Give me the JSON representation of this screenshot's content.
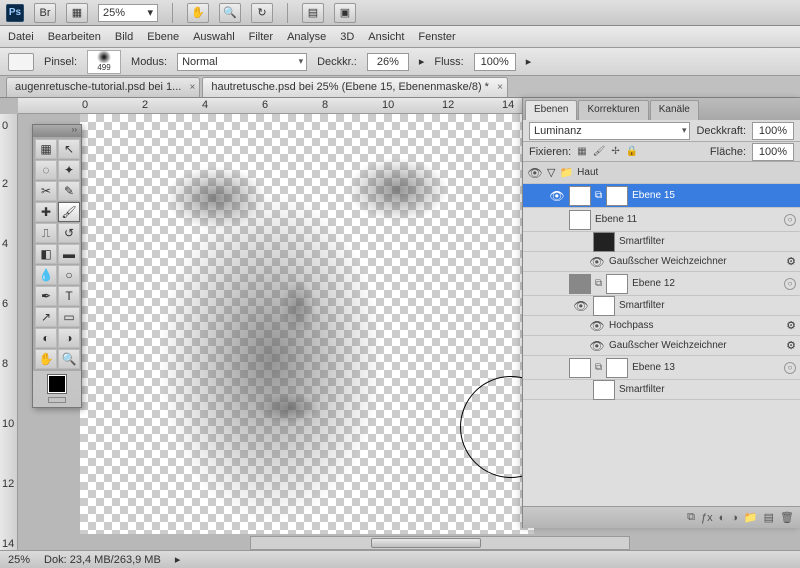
{
  "topbar": {
    "zoom": "25%"
  },
  "menu": [
    "Datei",
    "Bearbeiten",
    "Bild",
    "Ebene",
    "Auswahl",
    "Filter",
    "Analyse",
    "3D",
    "Ansicht",
    "Fenster"
  ],
  "options": {
    "brush_lbl": "Pinsel:",
    "brush_size": "499",
    "mode_lbl": "Modus:",
    "mode_val": "Normal",
    "opacity_lbl": "Deckkr.:",
    "opacity_val": "26%",
    "flow_lbl": "Fluss:",
    "flow_val": "100%"
  },
  "tabs": [
    {
      "label": "augenretusche-tutorial.psd bei 1...",
      "active": false
    },
    {
      "label": "hautretusche.psd bei 25% (Ebene 15, Ebenenmaske/8) *",
      "active": true
    }
  ],
  "ruler_h": [
    "0",
    "2",
    "4",
    "6",
    "8",
    "10",
    "12",
    "14"
  ],
  "ruler_v": [
    "0",
    "2",
    "4",
    "6",
    "8",
    "10",
    "12",
    "14"
  ],
  "panel": {
    "tabs": [
      "Ebenen",
      "Korrekturen",
      "Kanäle"
    ],
    "blend": "Luminanz",
    "opacity_lbl": "Deckkraft:",
    "opacity_val": "100%",
    "lock_lbl": "Fixieren:",
    "fill_lbl": "Fläche:",
    "fill_val": "100%"
  },
  "layers": {
    "group": "Haut",
    "items": [
      {
        "name": "Ebene 15",
        "sel": true
      },
      {
        "name": "Ebene 11"
      },
      {
        "name": "Smartfilter",
        "sf": true
      },
      {
        "name": "Gaußscher Weichzeichner",
        "eff": true
      },
      {
        "name": "Ebene 12"
      },
      {
        "name": "Smartfilter",
        "sf": true
      },
      {
        "name": "Hochpass",
        "eff": true
      },
      {
        "name": "Gaußscher Weichzeichner",
        "eff": true
      },
      {
        "name": "Ebene 13"
      },
      {
        "name": "Smartfilter",
        "sf": true
      }
    ]
  },
  "status": {
    "zoom": "25%",
    "doc": "Dok: 23,4 MB/263,9 MB"
  }
}
